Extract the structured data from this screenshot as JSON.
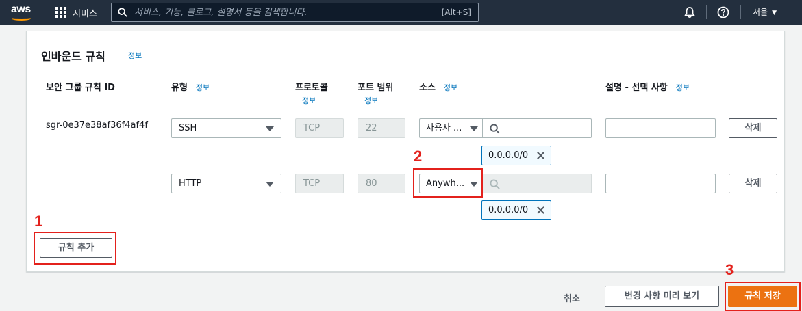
{
  "topnav": {
    "logo_text": "aws",
    "services_label": "서비스",
    "search_placeholder": "서비스, 기능, 블로그, 설명서 등을 검색합니다.",
    "search_shortcut": "[Alt+S]",
    "region_label": "서울",
    "icons": [
      "grid-icon",
      "search-icon",
      "bell-icon",
      "help-icon",
      "caret-down-icon"
    ]
  },
  "panel": {
    "title": "인바운드 규칙",
    "info_label": "정보",
    "columns": {
      "rule_id": "보안 그룹 규칙 ID",
      "type": "유형",
      "protocol": "프로토콜",
      "port_range": "포트 범위",
      "source": "소스",
      "description": "설명 - 선택 사항",
      "info": "정보"
    },
    "rows": [
      {
        "rule_id": "sgr-0e37e38af36f4af4f",
        "type": "SSH",
        "protocol": "TCP",
        "port": "22",
        "source_type": "사용자 ...",
        "cidr": "0.0.0.0/0",
        "description": "",
        "delete_label": "삭제"
      },
      {
        "rule_id": "–",
        "type": "HTTP",
        "protocol": "TCP",
        "port": "80",
        "source_type": "Anywh...",
        "cidr": "0.0.0.0/0",
        "description": "",
        "delete_label": "삭제"
      }
    ],
    "add_rule_label": "규칙 추가"
  },
  "footer": {
    "cancel_label": "취소",
    "preview_label": "변경 사항 미리 보기",
    "save_label": "규칙 저장"
  },
  "annotations": {
    "marker_1": "1",
    "marker_2": "2",
    "marker_3": "3"
  },
  "colors": {
    "nav_bg": "#232f3e",
    "primary": "#ec7211",
    "link": "#0073bb",
    "annotation": "#e3211c"
  }
}
